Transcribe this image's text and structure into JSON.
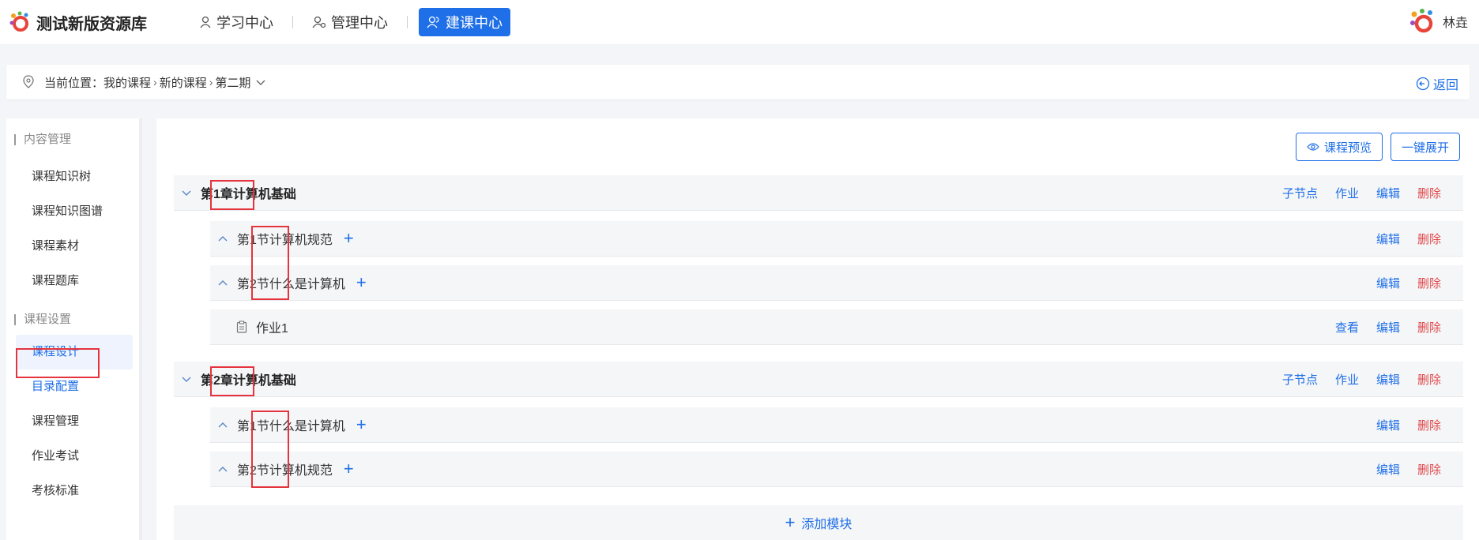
{
  "app": {
    "title": "测试新版资源库"
  },
  "nav": [
    {
      "label": "学习中心",
      "icon": "user-badge-icon",
      "active": false
    },
    {
      "label": "管理中心",
      "icon": "user-gear-icon",
      "active": false
    },
    {
      "label": "建课中心",
      "icon": "users-icon",
      "active": true
    }
  ],
  "user": {
    "name": "林垚"
  },
  "breadcrumb": {
    "prefix": "当前位置：",
    "items": [
      "我的课程",
      "新的课程",
      "第二期"
    ],
    "back_label": "返回"
  },
  "sidebar": {
    "groups": [
      {
        "title": "内容管理",
        "items": [
          "课程知识树",
          "课程知识图谱",
          "课程素材",
          "课程题库"
        ]
      },
      {
        "title": "课程设置",
        "items": [
          "课程设计",
          "目录配置",
          "课程管理",
          "作业考试",
          "考核标准"
        ]
      }
    ]
  },
  "toolbar": {
    "preview_label": "课程预览",
    "expand_label": "一键展开"
  },
  "chapters": [
    {
      "num": "第1章",
      "title": "计算机基础",
      "actions": [
        "子节点",
        "作业",
        "编辑",
        "删除"
      ],
      "sections": [
        {
          "num": "第1节",
          "title": "计算机规范",
          "actions": [
            "编辑",
            "删除"
          ]
        },
        {
          "num": "第2节",
          "title": "什么是计算机",
          "actions": [
            "编辑",
            "删除"
          ]
        }
      ],
      "homework": {
        "title": "作业1",
        "actions": [
          "查看",
          "编辑",
          "删除"
        ]
      }
    },
    {
      "num": "第2章",
      "title": "计算机基础",
      "actions": [
        "子节点",
        "作业",
        "编辑",
        "删除"
      ],
      "sections": [
        {
          "num": "第1节",
          "title": "什么是计算机",
          "actions": [
            "编辑",
            "删除"
          ]
        },
        {
          "num": "第2节",
          "title": "计算机规范",
          "actions": [
            "编辑",
            "删除"
          ]
        }
      ]
    }
  ],
  "add_module_label": "添加模块",
  "colors": {
    "accent": "#1f6fe8",
    "danger": "#e0484b",
    "highlight": "#e5343d"
  }
}
